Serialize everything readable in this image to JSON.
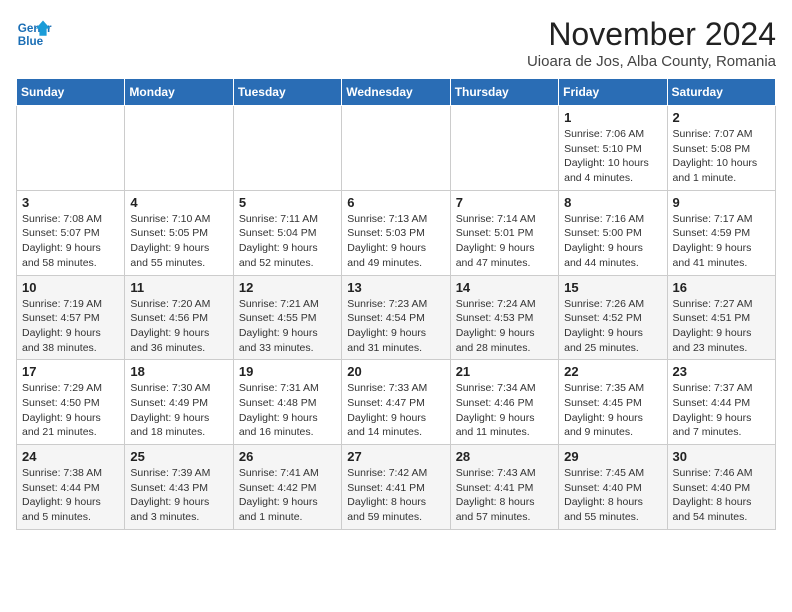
{
  "logo": {
    "line1": "General",
    "line2": "Blue"
  },
  "title": "November 2024",
  "subtitle": "Uioara de Jos, Alba County, Romania",
  "headers": [
    "Sunday",
    "Monday",
    "Tuesday",
    "Wednesday",
    "Thursday",
    "Friday",
    "Saturday"
  ],
  "rows": [
    [
      {
        "day": "",
        "sunrise": "",
        "sunset": "",
        "daylight": ""
      },
      {
        "day": "",
        "sunrise": "",
        "sunset": "",
        "daylight": ""
      },
      {
        "day": "",
        "sunrise": "",
        "sunset": "",
        "daylight": ""
      },
      {
        "day": "",
        "sunrise": "",
        "sunset": "",
        "daylight": ""
      },
      {
        "day": "",
        "sunrise": "",
        "sunset": "",
        "daylight": ""
      },
      {
        "day": "1",
        "sunrise": "Sunrise: 7:06 AM",
        "sunset": "Sunset: 5:10 PM",
        "daylight": "Daylight: 10 hours and 4 minutes."
      },
      {
        "day": "2",
        "sunrise": "Sunrise: 7:07 AM",
        "sunset": "Sunset: 5:08 PM",
        "daylight": "Daylight: 10 hours and 1 minute."
      }
    ],
    [
      {
        "day": "3",
        "sunrise": "Sunrise: 7:08 AM",
        "sunset": "Sunset: 5:07 PM",
        "daylight": "Daylight: 9 hours and 58 minutes."
      },
      {
        "day": "4",
        "sunrise": "Sunrise: 7:10 AM",
        "sunset": "Sunset: 5:05 PM",
        "daylight": "Daylight: 9 hours and 55 minutes."
      },
      {
        "day": "5",
        "sunrise": "Sunrise: 7:11 AM",
        "sunset": "Sunset: 5:04 PM",
        "daylight": "Daylight: 9 hours and 52 minutes."
      },
      {
        "day": "6",
        "sunrise": "Sunrise: 7:13 AM",
        "sunset": "Sunset: 5:03 PM",
        "daylight": "Daylight: 9 hours and 49 minutes."
      },
      {
        "day": "7",
        "sunrise": "Sunrise: 7:14 AM",
        "sunset": "Sunset: 5:01 PM",
        "daylight": "Daylight: 9 hours and 47 minutes."
      },
      {
        "day": "8",
        "sunrise": "Sunrise: 7:16 AM",
        "sunset": "Sunset: 5:00 PM",
        "daylight": "Daylight: 9 hours and 44 minutes."
      },
      {
        "day": "9",
        "sunrise": "Sunrise: 7:17 AM",
        "sunset": "Sunset: 4:59 PM",
        "daylight": "Daylight: 9 hours and 41 minutes."
      }
    ],
    [
      {
        "day": "10",
        "sunrise": "Sunrise: 7:19 AM",
        "sunset": "Sunset: 4:57 PM",
        "daylight": "Daylight: 9 hours and 38 minutes."
      },
      {
        "day": "11",
        "sunrise": "Sunrise: 7:20 AM",
        "sunset": "Sunset: 4:56 PM",
        "daylight": "Daylight: 9 hours and 36 minutes."
      },
      {
        "day": "12",
        "sunrise": "Sunrise: 7:21 AM",
        "sunset": "Sunset: 4:55 PM",
        "daylight": "Daylight: 9 hours and 33 minutes."
      },
      {
        "day": "13",
        "sunrise": "Sunrise: 7:23 AM",
        "sunset": "Sunset: 4:54 PM",
        "daylight": "Daylight: 9 hours and 31 minutes."
      },
      {
        "day": "14",
        "sunrise": "Sunrise: 7:24 AM",
        "sunset": "Sunset: 4:53 PM",
        "daylight": "Daylight: 9 hours and 28 minutes."
      },
      {
        "day": "15",
        "sunrise": "Sunrise: 7:26 AM",
        "sunset": "Sunset: 4:52 PM",
        "daylight": "Daylight: 9 hours and 25 minutes."
      },
      {
        "day": "16",
        "sunrise": "Sunrise: 7:27 AM",
        "sunset": "Sunset: 4:51 PM",
        "daylight": "Daylight: 9 hours and 23 minutes."
      }
    ],
    [
      {
        "day": "17",
        "sunrise": "Sunrise: 7:29 AM",
        "sunset": "Sunset: 4:50 PM",
        "daylight": "Daylight: 9 hours and 21 minutes."
      },
      {
        "day": "18",
        "sunrise": "Sunrise: 7:30 AM",
        "sunset": "Sunset: 4:49 PM",
        "daylight": "Daylight: 9 hours and 18 minutes."
      },
      {
        "day": "19",
        "sunrise": "Sunrise: 7:31 AM",
        "sunset": "Sunset: 4:48 PM",
        "daylight": "Daylight: 9 hours and 16 minutes."
      },
      {
        "day": "20",
        "sunrise": "Sunrise: 7:33 AM",
        "sunset": "Sunset: 4:47 PM",
        "daylight": "Daylight: 9 hours and 14 minutes."
      },
      {
        "day": "21",
        "sunrise": "Sunrise: 7:34 AM",
        "sunset": "Sunset: 4:46 PM",
        "daylight": "Daylight: 9 hours and 11 minutes."
      },
      {
        "day": "22",
        "sunrise": "Sunrise: 7:35 AM",
        "sunset": "Sunset: 4:45 PM",
        "daylight": "Daylight: 9 hours and 9 minutes."
      },
      {
        "day": "23",
        "sunrise": "Sunrise: 7:37 AM",
        "sunset": "Sunset: 4:44 PM",
        "daylight": "Daylight: 9 hours and 7 minutes."
      }
    ],
    [
      {
        "day": "24",
        "sunrise": "Sunrise: 7:38 AM",
        "sunset": "Sunset: 4:44 PM",
        "daylight": "Daylight: 9 hours and 5 minutes."
      },
      {
        "day": "25",
        "sunrise": "Sunrise: 7:39 AM",
        "sunset": "Sunset: 4:43 PM",
        "daylight": "Daylight: 9 hours and 3 minutes."
      },
      {
        "day": "26",
        "sunrise": "Sunrise: 7:41 AM",
        "sunset": "Sunset: 4:42 PM",
        "daylight": "Daylight: 9 hours and 1 minute."
      },
      {
        "day": "27",
        "sunrise": "Sunrise: 7:42 AM",
        "sunset": "Sunset: 4:41 PM",
        "daylight": "Daylight: 8 hours and 59 minutes."
      },
      {
        "day": "28",
        "sunrise": "Sunrise: 7:43 AM",
        "sunset": "Sunset: 4:41 PM",
        "daylight": "Daylight: 8 hours and 57 minutes."
      },
      {
        "day": "29",
        "sunrise": "Sunrise: 7:45 AM",
        "sunset": "Sunset: 4:40 PM",
        "daylight": "Daylight: 8 hours and 55 minutes."
      },
      {
        "day": "30",
        "sunrise": "Sunrise: 7:46 AM",
        "sunset": "Sunset: 4:40 PM",
        "daylight": "Daylight: 8 hours and 54 minutes."
      }
    ]
  ]
}
